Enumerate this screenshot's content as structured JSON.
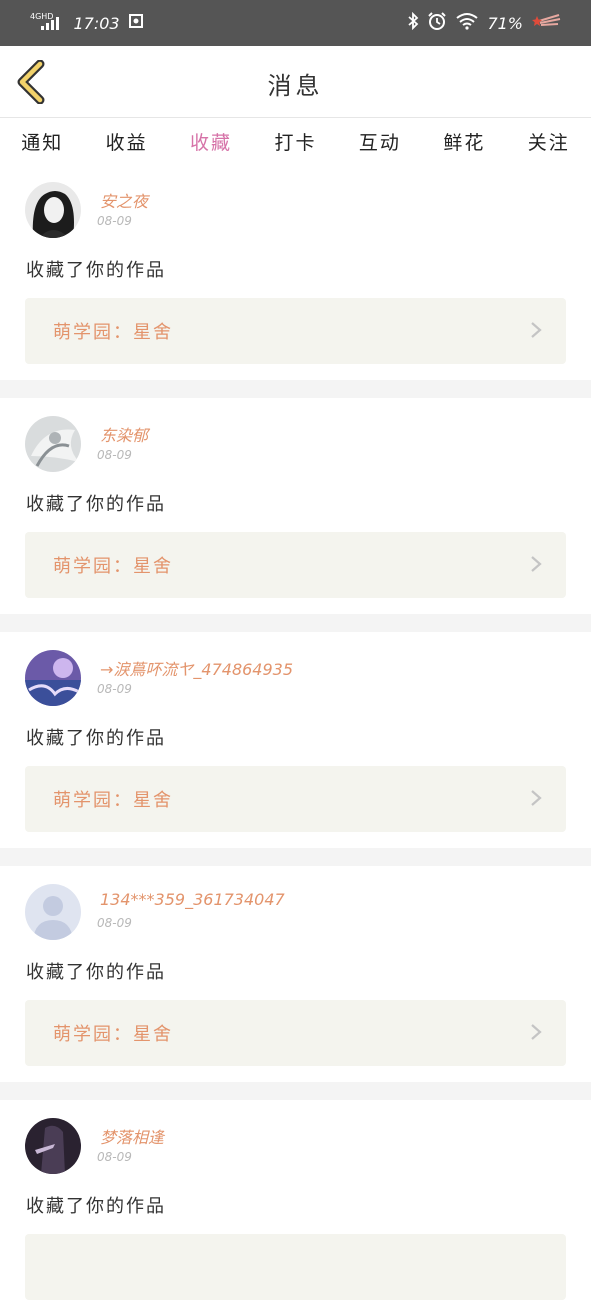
{
  "status_bar": {
    "network": "4GHD",
    "time": "17:03",
    "battery": "71%"
  },
  "header": {
    "title": "消息"
  },
  "tabs": [
    {
      "label": "通知",
      "active": false
    },
    {
      "label": "收益",
      "active": false
    },
    {
      "label": "收藏",
      "active": true
    },
    {
      "label": "打卡",
      "active": false
    },
    {
      "label": "互动",
      "active": false
    },
    {
      "label": "鲜花",
      "active": false
    },
    {
      "label": "关注",
      "active": false
    }
  ],
  "messages": [
    {
      "username": "安之夜",
      "date": "08-09",
      "action": "收藏了你的作品",
      "work": "萌学园：星舍"
    },
    {
      "username": "东染郁",
      "date": "08-09",
      "action": "收藏了你的作品",
      "work": "萌学园：星舍"
    },
    {
      "username": "→淚蔦吥流ヤ_474864935",
      "date": "08-09",
      "action": "收藏了你的作品",
      "work": "萌学园：星舍"
    },
    {
      "username": "134***359_361734047",
      "date": "08-09",
      "action": "收藏了你的作品",
      "work": "萌学园：星舍"
    },
    {
      "username": "梦落相逢",
      "date": "08-09",
      "action": "收藏了你的作品",
      "work": ""
    }
  ],
  "colors": {
    "accent_tab": "#d673a8",
    "username": "#e3946c",
    "card_bg": "#f4f4ee"
  }
}
